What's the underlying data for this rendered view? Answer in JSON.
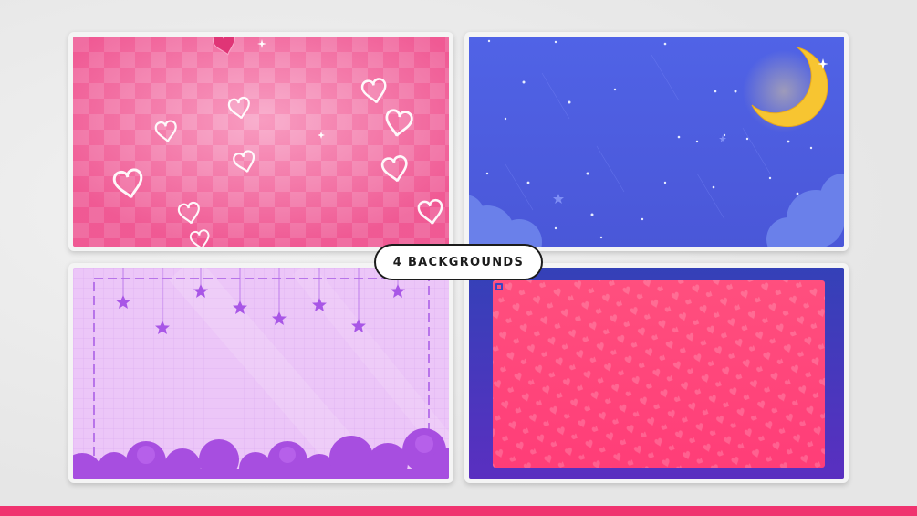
{
  "badge": {
    "label": "4 BACKGROUNDS"
  },
  "backgrounds": [
    {
      "theme": "pink-checkered-neon-hearts",
      "colors": {
        "base": "#f45d9c",
        "light": "#f98bbd"
      }
    },
    {
      "theme": "night-sky-crescent-moon",
      "colors": {
        "base": "#4d5ee0",
        "moon": "#f7c531"
      }
    },
    {
      "theme": "lavender-grid-hanging-stars-clouds",
      "colors": {
        "base": "#ebc0f8",
        "accent": "#a44ee2"
      }
    },
    {
      "theme": "coral-hearts-pattern-blue-frame",
      "colors": {
        "frame": "#2f3ab8",
        "panel": "#ff3d78"
      }
    }
  ],
  "accent_bar_color": "#f0336f"
}
